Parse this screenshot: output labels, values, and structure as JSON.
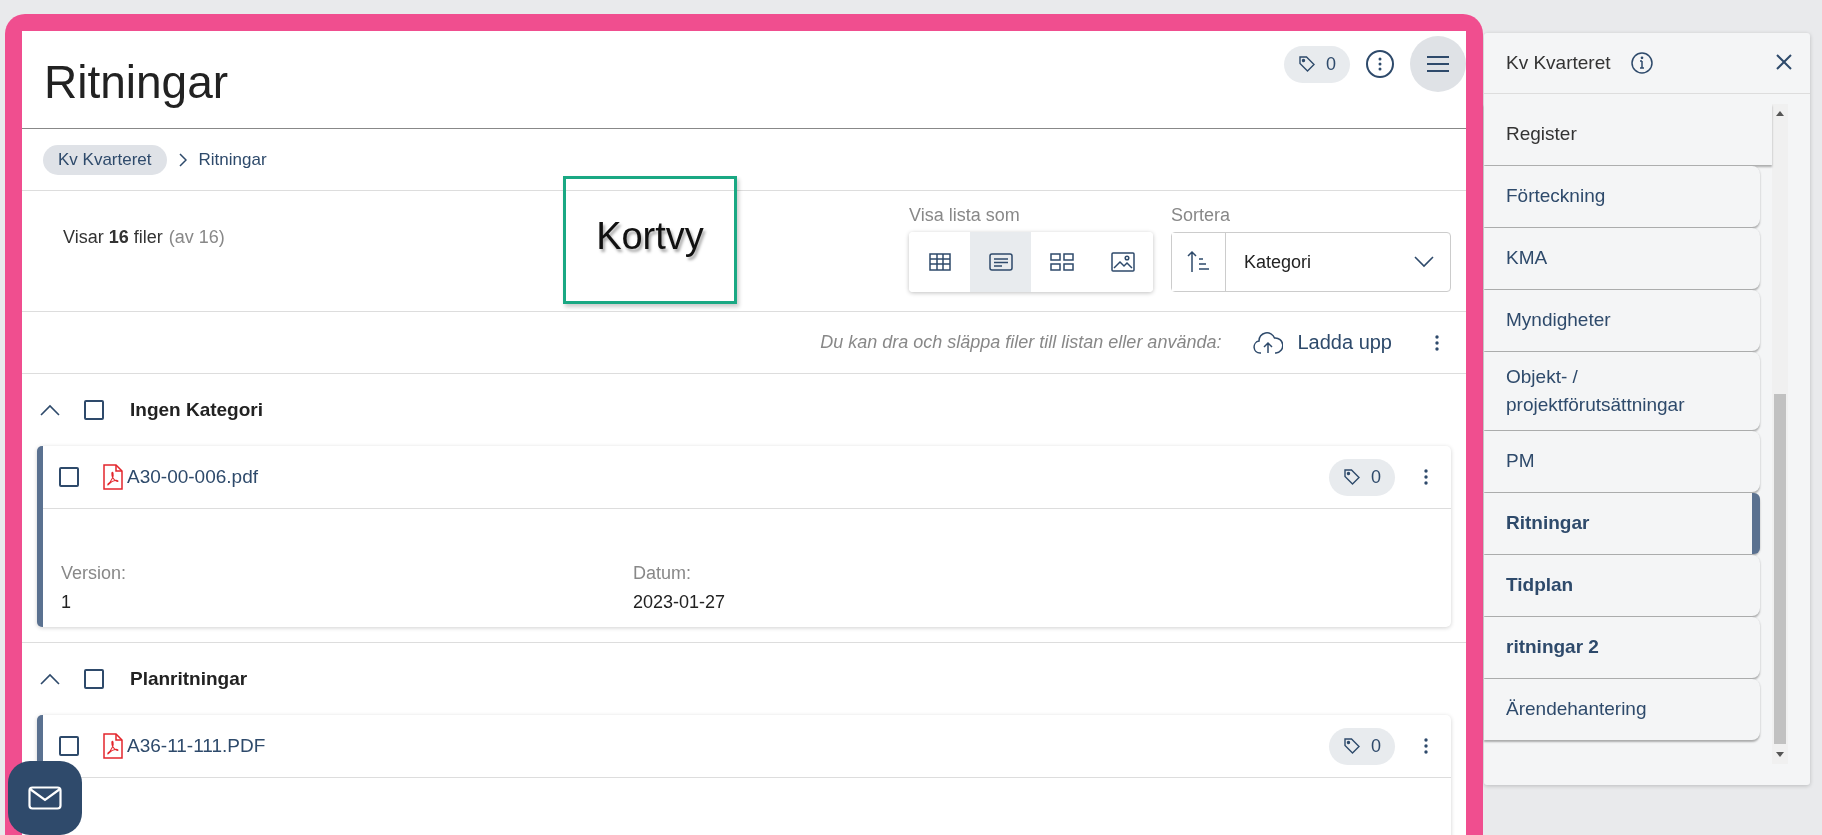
{
  "header": {
    "title": "Ritningar",
    "tag_count": "0"
  },
  "breadcrumb": [
    {
      "label": "Kv Kvarteret",
      "kind": "link"
    },
    {
      "label": "Ritningar",
      "kind": "current"
    }
  ],
  "summary": {
    "text": "Visar **16** filer",
    "total": "(av 16)"
  },
  "annotation": {
    "text": "Kortvy"
  },
  "view_switch": {
    "label": "Visa lista som",
    "options": [
      {
        "kind": "table",
        "selected": false
      },
      {
        "kind": "card",
        "selected": true
      },
      {
        "kind": "grid",
        "selected": false
      },
      {
        "kind": "image",
        "selected": false
      }
    ]
  },
  "sort": {
    "label": "Sortera",
    "value": "Kategori"
  },
  "upload": {
    "hint": "Du kan dra och släppa filer till listan eller använda:",
    "button": "Ladda upp"
  },
  "groups": [
    {
      "name": "Ingen Kategori",
      "expanded": true,
      "checked": false,
      "files": [
        {
          "name": "A30-00-006.pdf",
          "checked": false,
          "tag_count": "0",
          "fields": [
            {
              "label": "Version:",
              "value": "1"
            },
            {
              "label": "Datum:",
              "value": "2023-01-27"
            }
          ]
        }
      ]
    },
    {
      "name": "Planritningar",
      "expanded": true,
      "checked": false,
      "files": [
        {
          "name": "A36-11-111.PDF",
          "checked": false,
          "tag_count": "0"
        }
      ]
    }
  ],
  "sidebar": {
    "title": "Kv Kvarteret",
    "items": [
      {
        "label": "Register",
        "kind": "section",
        "selected": false,
        "emphasized": false
      },
      {
        "label": "Förteckning",
        "kind": "folder",
        "selected": false,
        "emphasized": false
      },
      {
        "label": "KMA",
        "kind": "folder",
        "selected": false,
        "emphasized": false
      },
      {
        "label": "Myndigheter",
        "kind": "folder",
        "selected": false,
        "emphasized": false
      },
      {
        "label": "Objekt- / projektförutsättningar",
        "kind": "folder",
        "selected": false,
        "emphasized": false
      },
      {
        "label": "PM",
        "kind": "folder",
        "selected": false,
        "emphasized": false
      },
      {
        "label": "Ritningar",
        "kind": "folder",
        "selected": true,
        "emphasized": true
      },
      {
        "label": "Tidplan",
        "kind": "folder",
        "selected": false,
        "emphasized": true
      },
      {
        "label": "ritningar 2",
        "kind": "folder",
        "selected": false,
        "emphasized": true
      },
      {
        "label": "Ärendehantering",
        "kind": "folder",
        "selected": false,
        "emphasized": false
      }
    ]
  }
}
